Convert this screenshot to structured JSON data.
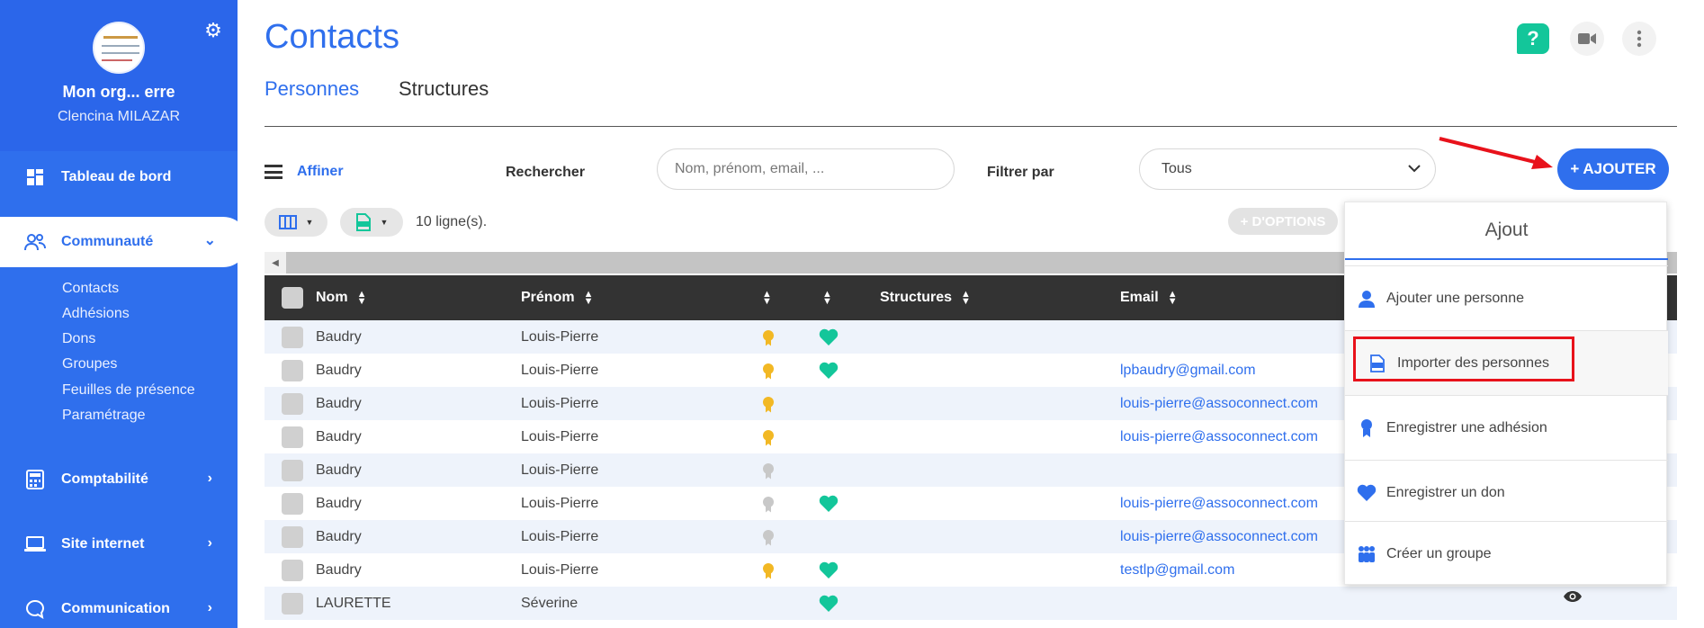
{
  "sidebar": {
    "org_name": "Mon org... erre",
    "user_name": "Clencina MILAZAR",
    "nav": [
      {
        "label": "Tableau de bord",
        "icon": "dashboard-icon"
      },
      {
        "label": "Communauté",
        "icon": "community-icon"
      },
      {
        "label": "Comptabilité",
        "icon": "calculator-icon"
      },
      {
        "label": "Site internet",
        "icon": "laptop-icon"
      },
      {
        "label": "Communication",
        "icon": "chat-icon"
      }
    ],
    "sub_items": [
      "Contacts",
      "Adhésions",
      "Dons",
      "Groupes",
      "Feuilles de présence",
      "Paramétrage"
    ]
  },
  "header": {
    "title": "Contacts",
    "tabs": [
      "Personnes",
      "Structures"
    ],
    "help_label": "?"
  },
  "filters": {
    "affiner_label": "Affiner",
    "search_label": "Rechercher",
    "search_placeholder": "Nom, prénom, email, ...",
    "filter_label": "Filtrer par",
    "filter_value": "Tous",
    "add_label": "+ AJOUTER"
  },
  "toolbar": {
    "rows_count": "10 ligne(s).",
    "options_label": "+ D'OPTIONS"
  },
  "table": {
    "headers": [
      "Nom",
      "Prénom",
      "Structures",
      "Email"
    ],
    "rows": [
      {
        "nom": "Baudry",
        "prenom": "Louis-Pierre",
        "medal": "gold",
        "heart": true,
        "email": ""
      },
      {
        "nom": "Baudry",
        "prenom": "Louis-Pierre",
        "medal": "gold",
        "heart": true,
        "email": "lpbaudry@gmail.com"
      },
      {
        "nom": "Baudry",
        "prenom": "Louis-Pierre",
        "medal": "gold",
        "heart": false,
        "email": "louis-pierre@assoconnect.com"
      },
      {
        "nom": "Baudry",
        "prenom": "Louis-Pierre",
        "medal": "gold",
        "heart": false,
        "email": "louis-pierre@assoconnect.com"
      },
      {
        "nom": "Baudry",
        "prenom": "Louis-Pierre",
        "medal": "grey",
        "heart": false,
        "email": ""
      },
      {
        "nom": "Baudry",
        "prenom": "Louis-Pierre",
        "medal": "grey",
        "heart": true,
        "email": "louis-pierre@assoconnect.com"
      },
      {
        "nom": "Baudry",
        "prenom": "Louis-Pierre",
        "medal": "grey",
        "heart": false,
        "email": "louis-pierre@assoconnect.com"
      },
      {
        "nom": "Baudry",
        "prenom": "Louis-Pierre",
        "medal": "gold",
        "heart": true,
        "email": "testlp@gmail.com"
      },
      {
        "nom": "LAURETTE",
        "prenom": "Séverine",
        "medal": "",
        "heart": true,
        "email": ""
      }
    ]
  },
  "dropdown": {
    "title": "Ajout",
    "items": [
      {
        "label": "Ajouter une personne",
        "icon": "person-icon"
      },
      {
        "label": "Importer des personnes",
        "icon": "xls-file-icon"
      },
      {
        "label": "Enregistrer une adhésion",
        "icon": "membership-ribbon-icon"
      },
      {
        "label": "Enregistrer un don",
        "icon": "heart-icon"
      },
      {
        "label": "Créer un groupe",
        "icon": "group-icon"
      }
    ]
  },
  "colors": {
    "primary": "#2f6fed",
    "accent_green": "#13c69a",
    "gold": "#f2b824",
    "highlight_red": "#e8121b",
    "header_dark": "#333333"
  }
}
